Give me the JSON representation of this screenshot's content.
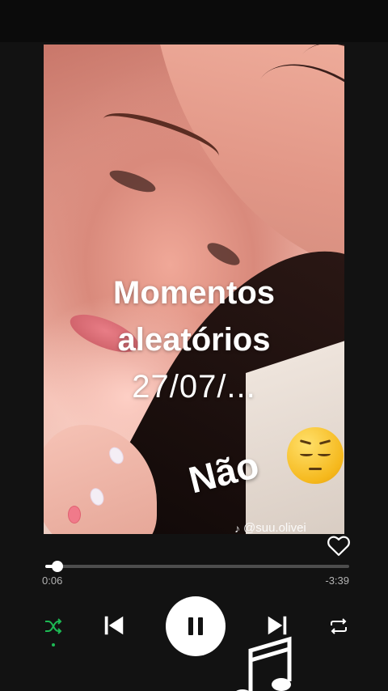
{
  "cover": {
    "title_line1": "Momentos",
    "title_line2": "aleatórios",
    "title_line3": "27/07/...",
    "sticker_text": "Não",
    "emoji_icon": "pensive-face-icon",
    "watermark": "@suu.olivei",
    "watermark_icon": "tiktok-icon"
  },
  "player": {
    "elapsed": "0:06",
    "remaining": "-3:39",
    "progress_fraction": 0.04,
    "shuffle_active": true,
    "is_playing": true
  },
  "colors": {
    "background": "#121212",
    "accent": "#1db954",
    "track": "#4d4d4d",
    "text_secondary": "#b3b3b3"
  }
}
